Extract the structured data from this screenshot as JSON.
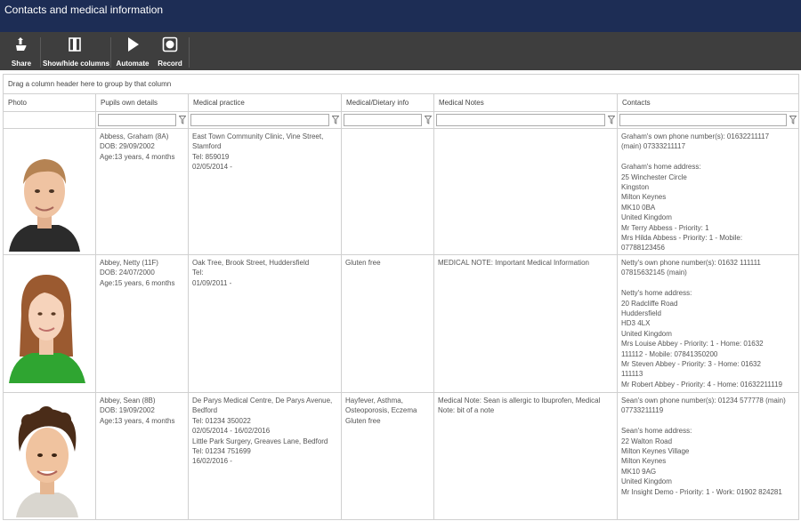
{
  "window": {
    "title": "Contacts and medical information"
  },
  "toolbar": {
    "share": "Share",
    "show_hide": "Show/hide columns",
    "automate": "Automate",
    "record": "Record"
  },
  "grid": {
    "group_hint": "Drag a column header here to group by that column",
    "columns": [
      "Photo",
      "Pupils own details",
      "Medical practice",
      "Medical/Dietary info",
      "Medical Notes",
      "Contacts"
    ],
    "rows": [
      {
        "details": [
          "Abbess, Graham (8A)",
          "DOB: 29/09/2002",
          "Age:13 years, 4 months"
        ],
        "practice": [
          "East Town Community Clinic, Vine Street,",
          "Stamford",
          "Tel: 859019",
          "02/05/2014 -"
        ],
        "dietary": [],
        "notes": [],
        "contacts": [
          "Graham's own phone number(s): 01632211117",
          "(main) 07333211117",
          "",
          "Graham's home address:",
          "25 Winchester Circle",
          "Kingston",
          "Milton Keynes",
          "MK10 0BA",
          "United Kingdom",
          "Mr Terry Abbess - Priority: 1",
          "Mrs Hilda Abbess - Priority: 1 - Mobile:",
          "07788123456"
        ]
      },
      {
        "details": [
          "Abbey, Netty (11F)",
          "DOB: 24/07/2000",
          "Age:15 years, 6 months"
        ],
        "practice": [
          "Oak Tree, Brook Street, Huddersfield",
          "Tel:",
          "01/09/2011 -"
        ],
        "dietary": [
          "Gluten free"
        ],
        "notes": [
          "MEDICAL NOTE: Important Medical Information"
        ],
        "contacts": [
          "Netty's own phone number(s): 01632 111111",
          "07815632145 (main)",
          "",
          "Netty's home address:",
          "20 Radcliffe Road",
          "Huddersfield",
          "HD3 4LX",
          "United Kingdom",
          "Mrs Louise Abbey - Priority: 1 - Home: 01632",
          "111112 - Mobile: 07841350200",
          "Mr Steven Abbey - Priority: 3 - Home: 01632",
          "111113",
          "Mr Robert Abbey - Priority: 4 - Home: 01632211119"
        ]
      },
      {
        "details": [
          "Abbey, Sean (8B)",
          "DOB: 19/09/2002",
          "Age:13 years, 4 months"
        ],
        "practice": [
          "De Parys Medical Centre, De Parys Avenue,",
          "Bedford",
          "Tel: 01234 350022",
          "02/05/2014 - 16/02/2016",
          "Little Park Surgery, Greaves Lane, Bedford",
          "Tel: 01234 751699",
          "16/02/2016 -"
        ],
        "dietary": [
          "Hayfever, Asthma,",
          "Osteoporosis, Eczema",
          "Gluten free"
        ],
        "notes": [
          "Medical Note: Sean is allergic to Ibuprofen, Medical",
          "Note: bit of a note"
        ],
        "contacts": [
          "Sean's own phone number(s): 01234 577778 (main)",
          "07733211119",
          "",
          "Sean's home address:",
          "22 Walton Road",
          "Milton Keynes Village",
          "Milton Keynes",
          "MK10 9AG",
          "United Kingdom",
          "Mr Insight Demo - Priority: 1 - Work: 01902 824281"
        ]
      }
    ]
  }
}
